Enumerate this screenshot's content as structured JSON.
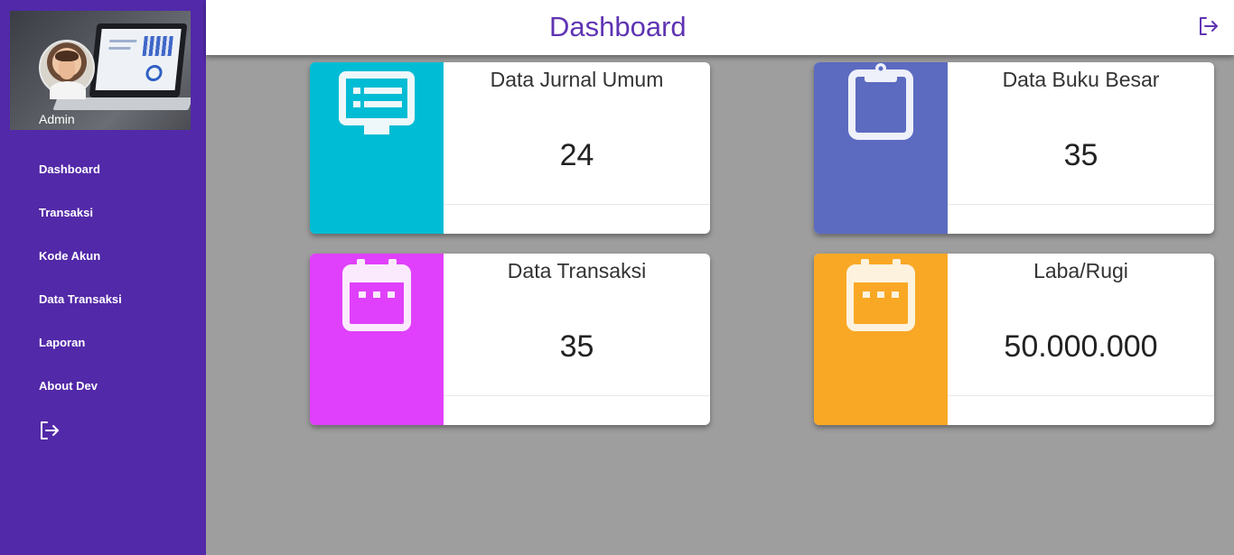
{
  "sidebar": {
    "profile": {
      "name": "Admin"
    },
    "items": [
      {
        "label": "Dashboard"
      },
      {
        "label": "Transaksi"
      },
      {
        "label": "Kode Akun"
      },
      {
        "label": "Data Transaksi"
      },
      {
        "label": "Laporan"
      },
      {
        "label": "About Dev"
      }
    ],
    "logout_icon": "logout-icon"
  },
  "header": {
    "title": "Dashboard",
    "logout_icon": "logout-icon"
  },
  "cards": [
    {
      "title": "Data Jurnal Umum",
      "value": "24",
      "icon": "monitor-list-icon",
      "color": "#00bcd4"
    },
    {
      "title": "Data Buku Besar",
      "value": "35",
      "icon": "clipboard-icon",
      "color": "#5c6bc0"
    },
    {
      "title": "Data Transaksi",
      "value": "35",
      "icon": "calendar-icon",
      "color": "#e040fb"
    },
    {
      "title": "Laba/Rugi",
      "value": "50.000.000",
      "icon": "calendar-icon",
      "color": "#f9a825"
    }
  ],
  "colors": {
    "sidebar_bg": "#5229a8",
    "title_accent": "#5f34b3",
    "content_bg": "#9e9e9e"
  }
}
